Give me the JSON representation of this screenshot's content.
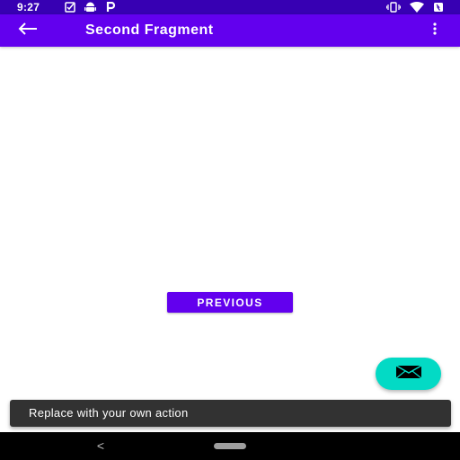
{
  "status_bar": {
    "time": "9:27",
    "left_icons": [
      "task-check-icon",
      "android-icon",
      "parking-icon"
    ],
    "right_icons": [
      "vibrate-icon",
      "wifi-icon",
      "battery-icon"
    ]
  },
  "app_bar": {
    "title": "Second Fragment",
    "back_icon": "arrow-back-icon",
    "overflow_icon": "more-vert-icon"
  },
  "main": {
    "previous_label": "PREVIOUS"
  },
  "fab": {
    "icon": "email-icon"
  },
  "snackbar": {
    "message": "Replace with your own action"
  },
  "nav_bar": {
    "back_glyph": "<"
  },
  "colors": {
    "status_bar": "#3700b3",
    "primary": "#6200ee",
    "secondary": "#03dac5",
    "snackbar": "#323232",
    "nav_bar": "#000000"
  }
}
